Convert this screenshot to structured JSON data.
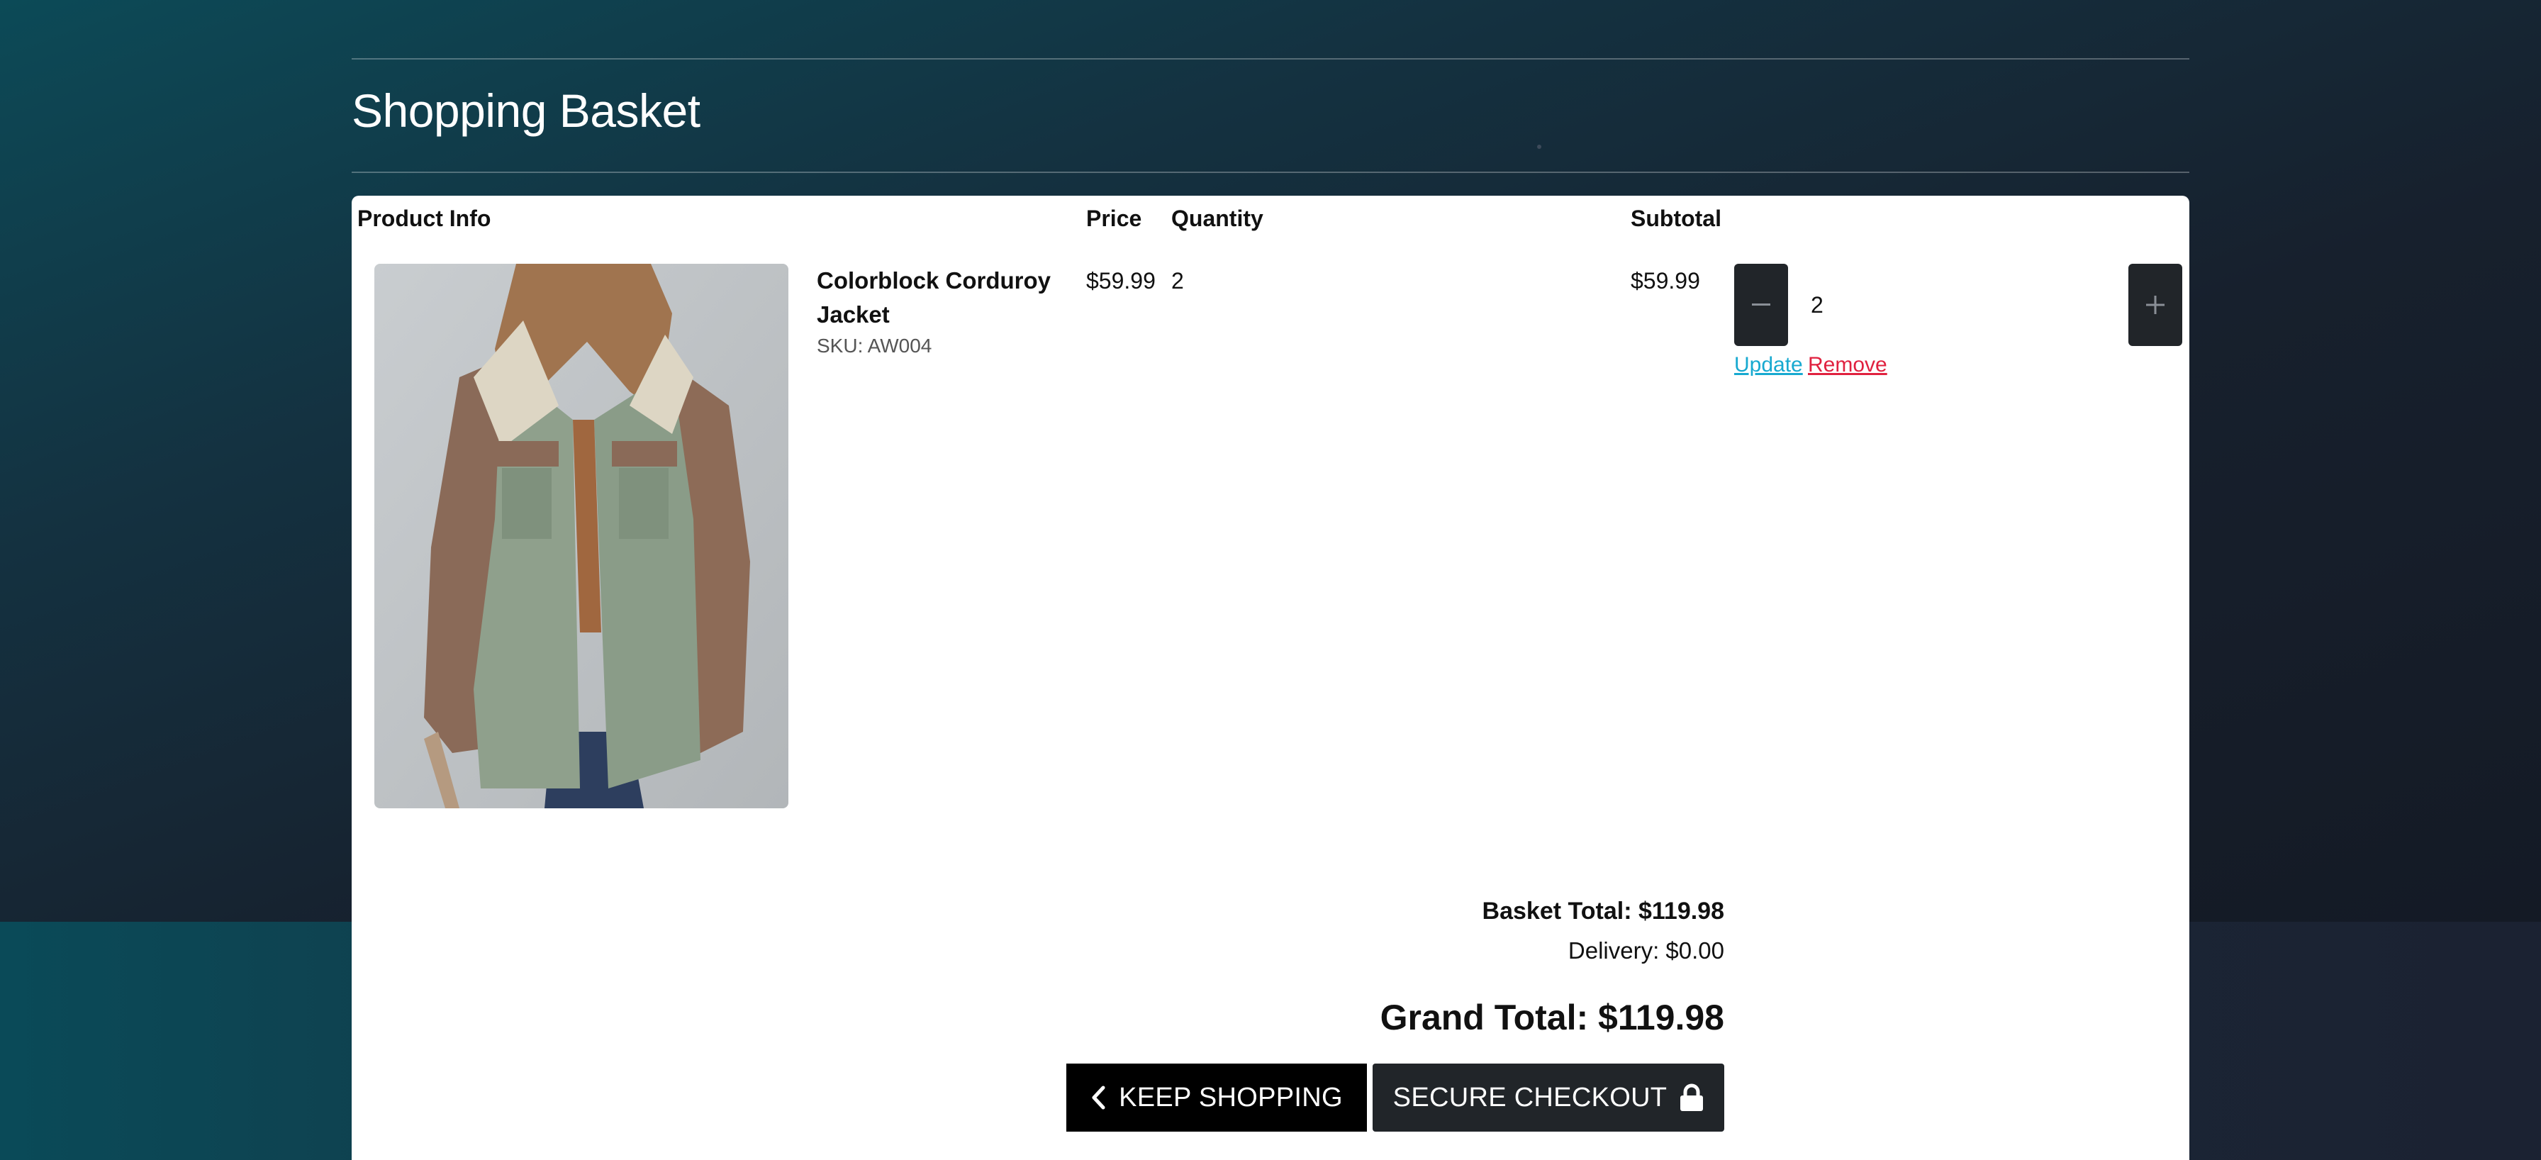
{
  "page": {
    "title": "Shopping Basket"
  },
  "table": {
    "headers": {
      "product_info": "Product Info",
      "price": "Price",
      "quantity": "Quantity",
      "subtotal": "Subtotal"
    }
  },
  "basket": {
    "items": [
      {
        "name": "Colorblock Corduroy Jacket",
        "sku": "SKU: AW004",
        "price": "$59.99",
        "quantity": "2",
        "subtotal": "$59.99",
        "qty_input_value": "2",
        "update_label": "Update",
        "remove_label": "Remove",
        "image_icon": "corduroy-jacket-photo"
      }
    ]
  },
  "summary": {
    "basket_total": "Basket Total: $119.98",
    "delivery": "Delivery: $0.00",
    "grand_total": "Grand Total: $119.98"
  },
  "actions": {
    "keep_shopping": "KEEP SHOPPING",
    "secure_checkout": "SECURE CHECKOUT",
    "keep_shopping_icon": "chevron-left-icon",
    "secure_checkout_icon": "lock-icon"
  },
  "colors": {
    "link_update": "#17a9d0",
    "link_remove": "#e0213f",
    "button_dark": "#212529",
    "button_black": "#000000"
  }
}
